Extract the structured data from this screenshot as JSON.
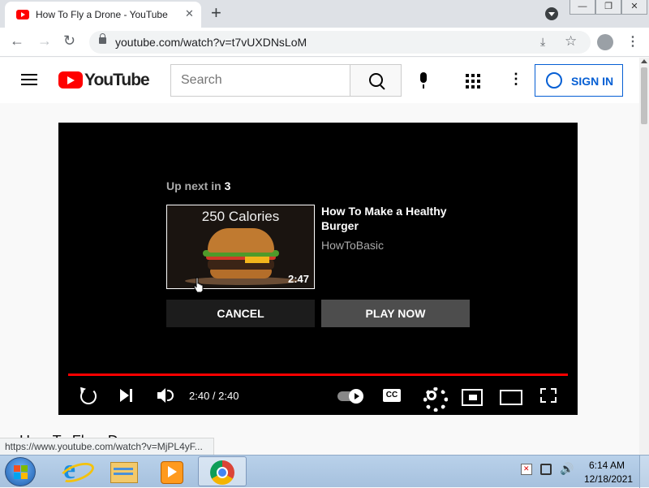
{
  "browser": {
    "tab_title": "How To Fly a Drone - YouTube",
    "tab_close": "✕",
    "new_tab": "+",
    "window_controls": {
      "minimize": "—",
      "maximize": "❐",
      "close": "✕"
    },
    "back": "←",
    "forward": "→",
    "reload": "↻",
    "url": "youtube.com/watch?v=t7vUXDNsLoM",
    "download_glyph": "⤓",
    "bookmark_glyph": "☆",
    "menu_glyph": "⋮"
  },
  "youtube_header": {
    "logo_text": "YouTube",
    "search_placeholder": "Search",
    "more_glyph": "⋮",
    "sign_in_label": "SIGN IN"
  },
  "player": {
    "up_next_prefix": "Up next in ",
    "up_next_countdown": "3",
    "thumbnail_text": "250 Calories",
    "next_duration": "2:47",
    "next_title": "How To Make a Healthy Burger",
    "next_channel": "HowToBasic",
    "cancel_label": "CANCEL",
    "play_now_label": "PLAY NOW",
    "time_display": "2:40 / 2:40",
    "progress_fraction": 1.0,
    "progress_color": "#ff0000"
  },
  "page": {
    "video_title_partial": "How To Fly a Drone"
  },
  "status_bar": {
    "link": "https://www.youtube.com/watch?v=MjPL4yF..."
  },
  "taskbar": {
    "time": "6:14 AM",
    "date": "12/18/2021",
    "volume_glyph": "🔊"
  }
}
